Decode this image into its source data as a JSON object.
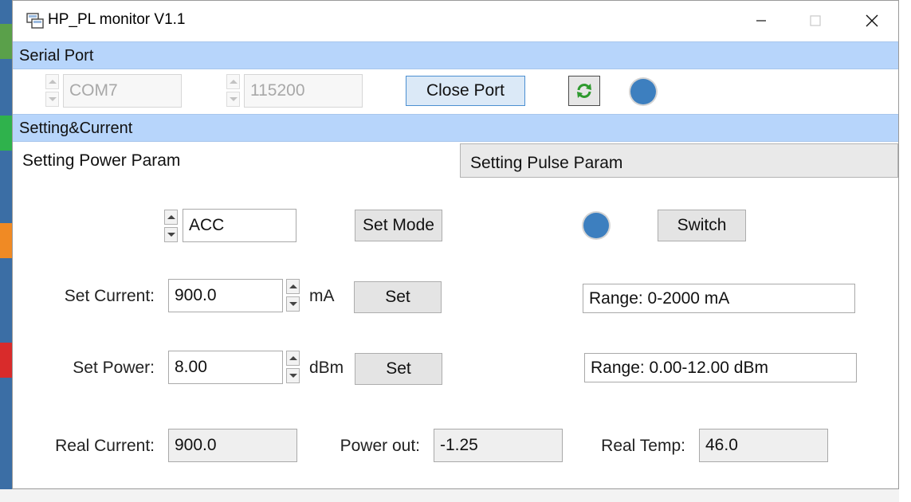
{
  "window": {
    "title": "HP_PL monitor V1.1"
  },
  "serial_port": {
    "header": "Serial Port",
    "port": "COM7",
    "baud": "115200",
    "close_button": "Close Port"
  },
  "setting_current": {
    "header": "Setting&Current",
    "tabs": [
      {
        "label": "Setting Power Param",
        "active": true
      },
      {
        "label": "Setting Pulse Param",
        "active": false
      }
    ]
  },
  "power_param": {
    "mode": "ACC",
    "set_mode_button": "Set Mode",
    "switch_button": "Switch",
    "set_current_label": "Set Current:",
    "set_current_value": "900.0",
    "current_unit": "mA",
    "set_button": "Set",
    "current_range": "Range: 0-2000 mA",
    "set_power_label": "Set Power:",
    "set_power_value": "8.00",
    "power_unit": "dBm",
    "power_range": "Range: 0.00-12.00 dBm",
    "real_current_label": "Real Current:",
    "real_current_value": "900.0",
    "power_out_label": "Power out:",
    "power_out_value": "-1.25",
    "real_temp_label": "Real Temp:",
    "real_temp_value": "46.0"
  },
  "icons": {
    "app": "app-window-icon",
    "refresh": "refresh-icon",
    "minimize": "minimize-icon",
    "maximize": "maximize-icon",
    "close": "close-icon"
  },
  "colors": {
    "section_bar": "#b7d5fb",
    "status_led": "#3d7fbf",
    "refresh_green": "#2e9a2e"
  }
}
